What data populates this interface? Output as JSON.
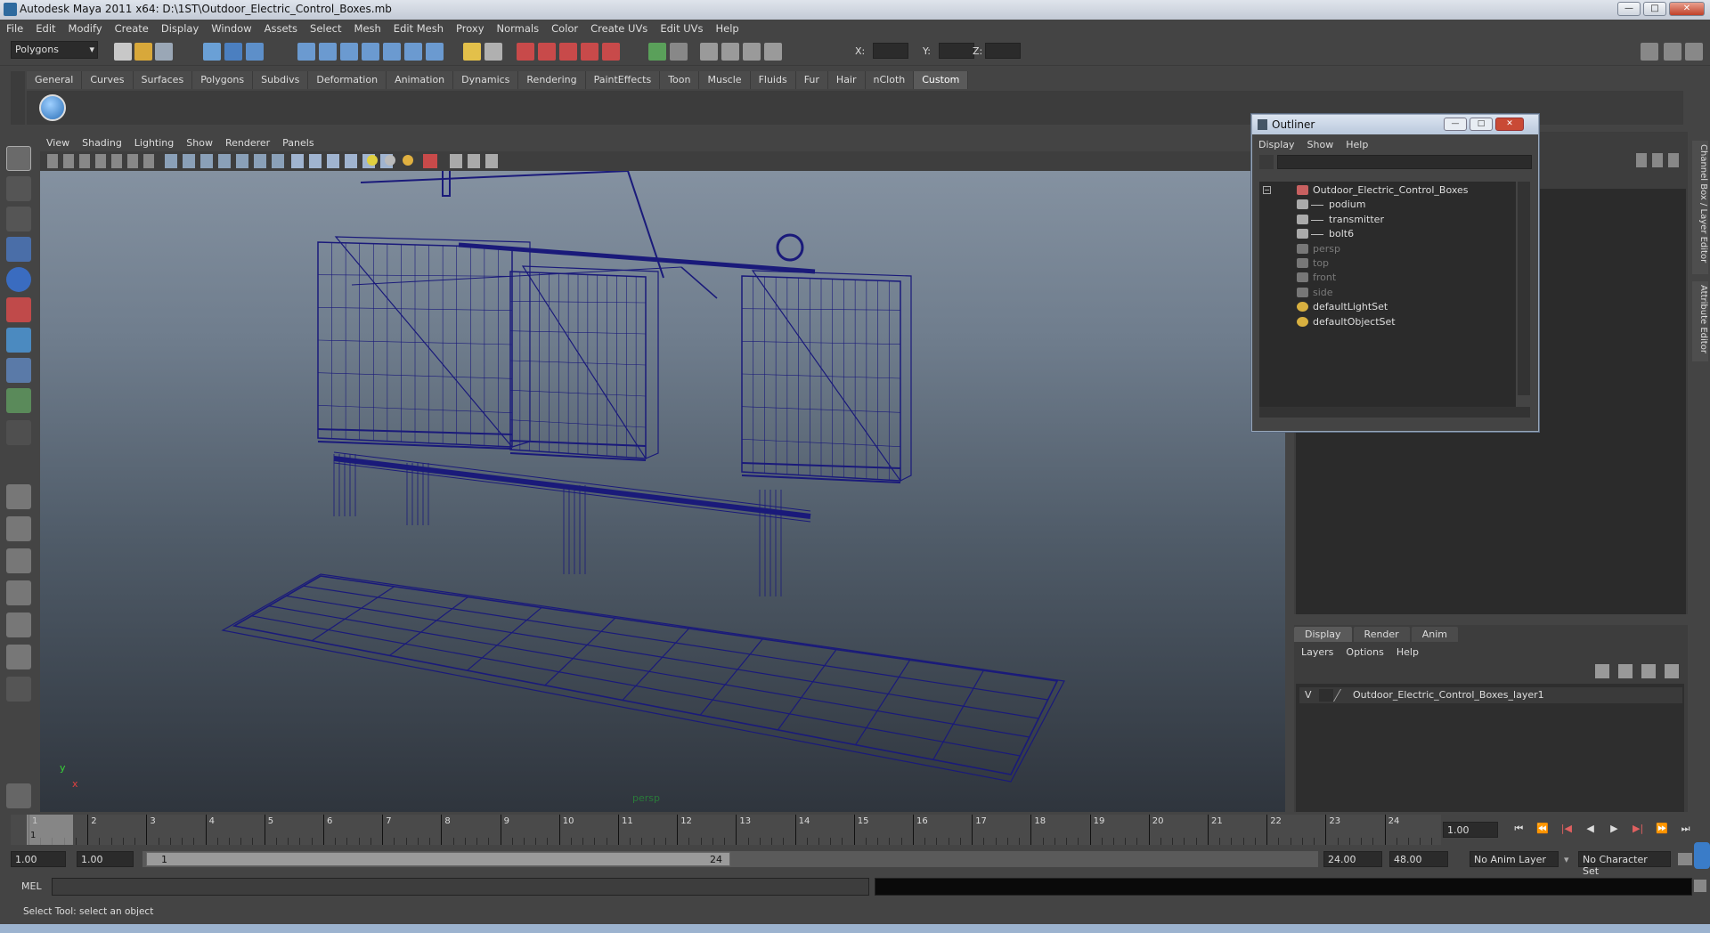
{
  "window": {
    "title": "Autodesk Maya 2011 x64: D:\\1ST\\Outdoor_Electric_Control_Boxes.mb",
    "minimize": "—",
    "maximize": "□",
    "close": "✕"
  },
  "menubar": [
    "File",
    "Edit",
    "Modify",
    "Create",
    "Display",
    "Window",
    "Assets",
    "Select",
    "Mesh",
    "Edit Mesh",
    "Proxy",
    "Normals",
    "Color",
    "Create UVs",
    "Edit UVs",
    "Help"
  ],
  "statusline": {
    "menuset": "Polygons",
    "x_label": "X:",
    "y_label": "Y:",
    "z_label": "Z:"
  },
  "shelf": {
    "tabs": [
      "General",
      "Curves",
      "Surfaces",
      "Polygons",
      "Subdivs",
      "Deformation",
      "Animation",
      "Dynamics",
      "Rendering",
      "PaintEffects",
      "Toon",
      "Muscle",
      "Fluids",
      "Fur",
      "Hair",
      "nCloth",
      "Custom"
    ],
    "active": "Custom"
  },
  "viewport": {
    "menu": [
      "View",
      "Shading",
      "Lighting",
      "Show",
      "Renderer",
      "Panels"
    ],
    "camera_label": "persp",
    "axis_x": "x",
    "axis_y": "y",
    "wire_color": "#1a1a7a"
  },
  "outliner": {
    "title": "Outliner",
    "menu": [
      "Display",
      "Show",
      "Help"
    ],
    "items": [
      {
        "label": "Outdoor_Electric_Control_Boxes",
        "indent": 0,
        "kind": "group",
        "dim": false
      },
      {
        "label": "podium",
        "indent": 1,
        "kind": "mesh",
        "dim": false
      },
      {
        "label": "transmitter",
        "indent": 1,
        "kind": "mesh",
        "dim": false
      },
      {
        "label": "bolt6",
        "indent": 1,
        "kind": "mesh",
        "dim": false
      },
      {
        "label": "persp",
        "indent": 0,
        "kind": "camera",
        "dim": true
      },
      {
        "label": "top",
        "indent": 0,
        "kind": "camera",
        "dim": true
      },
      {
        "label": "front",
        "indent": 0,
        "kind": "camera",
        "dim": true
      },
      {
        "label": "side",
        "indent": 0,
        "kind": "camera",
        "dim": true
      },
      {
        "label": "defaultLightSet",
        "indent": 0,
        "kind": "set",
        "dim": false
      },
      {
        "label": "defaultObjectSet",
        "indent": 0,
        "kind": "set",
        "dim": false
      }
    ]
  },
  "sidetabs": [
    "Channel Box / Layer Editor",
    "Attribute Editor"
  ],
  "layers": {
    "tabs": [
      "Display",
      "Render",
      "Anim"
    ],
    "active": "Display",
    "menu": [
      "Layers",
      "Options",
      "Help"
    ],
    "rows": [
      {
        "visible": "V",
        "name": "Outdoor_Electric_Control_Boxes_layer1"
      }
    ]
  },
  "timeline": {
    "ticks": [
      "1",
      "2",
      "3",
      "4",
      "5",
      "6",
      "7",
      "8",
      "9",
      "10",
      "11",
      "12",
      "13",
      "14",
      "15",
      "16",
      "17",
      "18",
      "19",
      "20",
      "21",
      "22",
      "23",
      "24"
    ],
    "current_frame": "1",
    "current_time_field": "1.00"
  },
  "range": {
    "start_time": "1.00",
    "playback_start": "1.00",
    "range_start_label": "1",
    "range_end_label": "24",
    "playback_end": "24.00",
    "end_time": "48.00",
    "anim_layer": "No Anim Layer",
    "character_set": "No Character Set"
  },
  "command": {
    "label": "MEL"
  },
  "helpline": "Select Tool: select an object"
}
